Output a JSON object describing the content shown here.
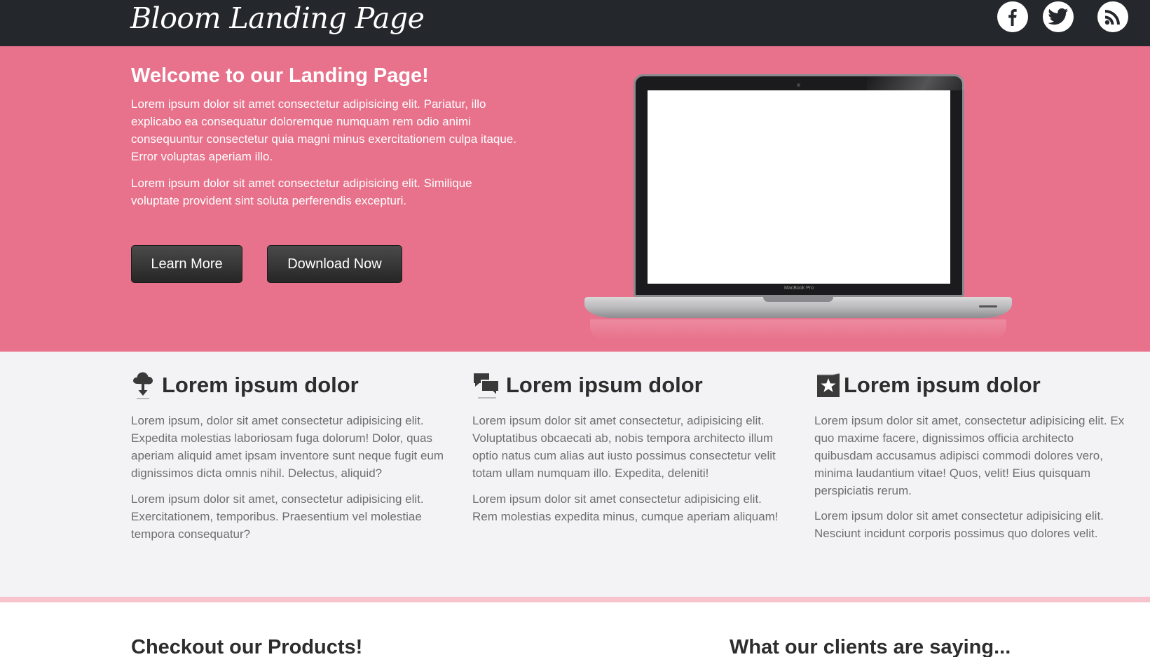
{
  "header": {
    "logo": "Bloom Landing Page",
    "social_icons": [
      "facebook-icon",
      "twitter-icon",
      "rss-icon"
    ]
  },
  "hero": {
    "title": "Welcome to our Landing Page!",
    "paragraph_1": "Lorem ipsum dolor sit amet consectetur adipisicing elit. Pariatur, illo explicabo ea consequatur doloremque numquam rem odio animi consequuntur consectetur quia magni minus exercitationem culpa itaque. Error voluptas aperiam illo.",
    "paragraph_2": "Lorem ipsum dolor sit amet consectetur adipisicing elit. Similique voluptate provident sint soluta perferendis excepturi.",
    "learn_more": "Learn More",
    "download_now": "Download Now",
    "laptop_label": "MacBook Pro",
    "background_color": "#e8718b"
  },
  "features": [
    {
      "icon": "cloud-download-icon",
      "title": "Lorem ipsum dolor",
      "paragraph_1": "Lorem ipsum, dolor sit amet consectetur adipisicing elit. Expedita molestias laboriosam fuga dolorum! Dolor, quas aperiam aliquid amet ipsam inventore sunt neque fugit eum dignissimos dicta omnis nihil. Delectus, aliquid?",
      "paragraph_2": "Lorem ipsum dolor sit amet, consectetur adipisicing elit. Exercitationem, temporibus. Praesentium vel molestiae tempora consequatur?"
    },
    {
      "icon": "chat-bubbles-icon",
      "title": "Lorem ipsum dolor",
      "paragraph_1": "Lorem ipsum dolor sit amet consectetur, adipisicing elit. Voluptatibus obcaecati ab, nobis tempora architecto illum optio natus cum alias aut iusto possimus consectetur velit totam ullam numquam illo. Expedita, deleniti!",
      "paragraph_2": "Lorem ipsum dolor sit amet consectetur adipisicing elit. Rem molestias expedita minus, cumque aperiam aliquam!"
    },
    {
      "icon": "star-badge-icon",
      "title": "Lorem ipsum dolor",
      "paragraph_1": "Lorem ipsum dolor sit amet, consectetur adipisicing elit. Ex quo maxime facere, dignissimos officia architecto quibusdam accusamus adipisci commodi dolores vero, minima laudantium vitae! Quos, velit! Eius quisquam perspiciatis rerum.",
      "paragraph_2": "Lorem ipsum dolor sit amet consectetur adipisicing elit. Nesciunt incidunt corporis possimus quo dolores velit."
    }
  ],
  "bottom": {
    "products_title": "Checkout our Products!",
    "clients_title": "What our clients are saying..."
  }
}
